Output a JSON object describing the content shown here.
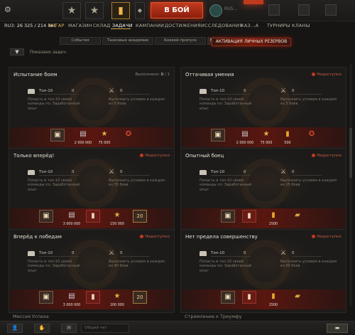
{
  "topbar": {
    "settings_icon": "gear-icon",
    "battle_label": "В БОЙ",
    "mode_text": "RUS..."
  },
  "nav": {
    "balance_label": "RU3:",
    "balance_value": "26 325 / 214 560",
    "items": [
      "АНГАР",
      "МАГАЗИН",
      "СКЛАД",
      "ЗАДАЧИ",
      "КАМПАНИИ",
      "ДОСТИЖЕНИЯ",
      "ИССЛЕДОВАНИЯ",
      "КАЗ...А",
      "ТУРНИРЫ",
      "КЛАНЫ"
    ],
    "active": "ЗАДАЧИ"
  },
  "subtabs": [
    "События",
    "Танковые академии",
    "Боевой пропуск",
    "Боев..."
  ],
  "reserve_button": "АКТИВАЦИЯ ЛИЧНЫХ РЕЗЕРВОВ",
  "filter": {
    "label": "Показано задач:"
  },
  "cards": [
    {
      "title": "Испытание боем",
      "status_label": "Выполнено:",
      "status_done": "0",
      "status_total": "/ 1",
      "c1_top": "Топ-10",
      "c1_val": "0",
      "c1_desc": "Попасть в топ-10 своей команды по: Заработанный опыт",
      "c2_val": "0",
      "c2_desc": "Выполнить условия в каждом из 5 боев",
      "rewards": [
        "2 000 000",
        "75 000"
      ]
    },
    {
      "title": "Оттачивая умения",
      "status_label": "Недоступно",
      "c1_top": "Топ-10",
      "c1_val": "0",
      "c1_desc": "Попасть в топ-10 своей команды по: Заработанный опыт",
      "c2_val": "0",
      "c2_desc": "Выполнить условия в каждом из 5 боев",
      "rewards": [
        "2 000 000",
        "75 000",
        "500"
      ]
    },
    {
      "title": "Только вперёд!",
      "status_label": "Недоступно",
      "c1_top": "Топ-10",
      "c1_val": "0",
      "c1_desc": "Попасть в топ-10 своей команды по: Заработанный опыт",
      "c2_val": "0",
      "c2_desc": "Выполнить условия в каждом из 35 боев",
      "rewards": [
        "3 000 000",
        "150 000",
        "20"
      ]
    },
    {
      "title": "Опытный боец",
      "status_label": "Недоступно",
      "c1_top": "Топ-10",
      "c1_val": "0",
      "c1_desc": "Попасть в топ-10 своей команды по: Заработанный опыт",
      "c2_val": "0",
      "c2_desc": "Выполнить условия в каждом из 25 боев",
      "rewards": [
        "2500"
      ]
    },
    {
      "title": "Вперёд к победам",
      "status_label": "Недоступно",
      "c1_top": "Топ-10",
      "c1_val": "0",
      "c1_desc": "Попасть в топ-10 своей команды по: Заработанный опыт",
      "c2_val": "0",
      "c2_desc": "Выполнить условия в каждом из 40 боев",
      "rewards": [
        "3 000 000",
        "200 000",
        "20"
      ]
    },
    {
      "title": "Нет предела совершенству",
      "status_label": "Недоступно",
      "c1_top": "Топ-10",
      "c1_val": "0",
      "c1_desc": "Попасть в топ-10 своей команды по: Заработанный опыт",
      "c2_val": "0",
      "c2_desc": "Выполнить условия в каждом из 60 боев",
      "rewards": [
        "2500"
      ]
    }
  ],
  "peek": [
    "Миссия Успеха",
    "Стремление к Триумфу"
  ],
  "bottom": {
    "chat_placeholder": "Общий чат"
  }
}
